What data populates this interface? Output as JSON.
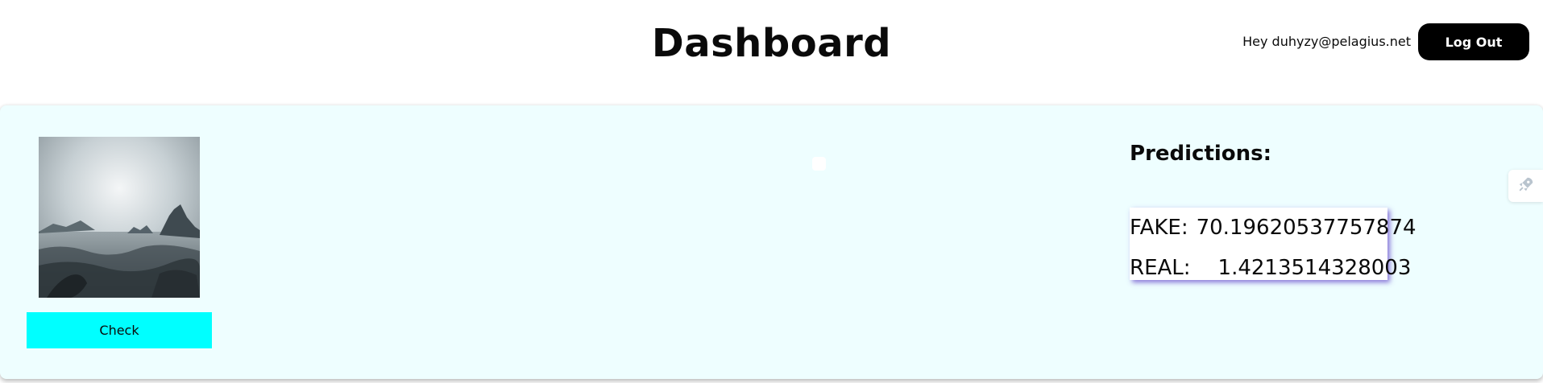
{
  "header": {
    "title": "Dashboard",
    "greeting": "Hey duhyzy@pelagius.net",
    "logout_label": "Log Out"
  },
  "main": {
    "check_label": "Check",
    "predictions": {
      "heading": "Predictions:",
      "items": [
        {
          "label": "FAKE:",
          "value": "70.19620537757874"
        },
        {
          "label": "REAL:",
          "value": "1.4213514328003"
        }
      ]
    }
  },
  "side_button": {
    "icon": "rocket-icon"
  },
  "colors": {
    "panel_background": "#eefeff",
    "check_button": "#00ffff",
    "logout_button": "#000000",
    "prediction_shadow": "#5c3cc8"
  }
}
